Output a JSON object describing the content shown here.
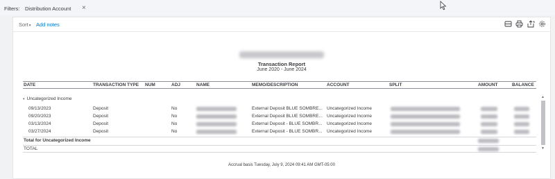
{
  "filters": {
    "label": "Filters:",
    "chip_label": "Distribution Account",
    "chip_remove": "×"
  },
  "toolbar": {
    "sort_label": "Sort",
    "sort_caret": "▾",
    "add_notes_label": "Add notes",
    "icons": [
      "collapse-icon",
      "print-icon",
      "export-icon",
      "settings-icon"
    ]
  },
  "report": {
    "title": "Transaction Report",
    "date_range": "June 2020 - June 2024",
    "columns": [
      "DATE",
      "TRANSACTION TYPE",
      "NUM",
      "ADJ",
      "NAME",
      "MEMO/DESCRIPTION",
      "ACCOUNT",
      "SPLIT",
      "AMOUNT",
      "BALANCE"
    ],
    "group_toggle": "▾",
    "group_label": "Uncategorized Income",
    "rows": [
      {
        "date": "09/13/2023",
        "type": "Deposit",
        "adj": "No",
        "memo": "External Deposit BLUE SOMBRE...",
        "account": "Uncategorized Income"
      },
      {
        "date": "09/20/2023",
        "type": "Deposit",
        "adj": "No",
        "memo": "External Deposit BLUE SOMBRE...",
        "account": "Uncategorized Income"
      },
      {
        "date": "03/13/2024",
        "type": "Deposit",
        "adj": "No",
        "memo": "External Deposit - BLUE SOMBR...",
        "account": "Uncategorized Income"
      },
      {
        "date": "03/27/2024",
        "type": "Deposit",
        "adj": "No",
        "memo": "External Deposit - BLUE SOMBR...",
        "account": "Uncategorized Income"
      }
    ],
    "total_group_label": "Total for Uncategorized Income",
    "total_label": "TOTAL",
    "footer": "Accrual basis  Tuesday, July 9, 2024  09:41 AM GMT-05:00"
  },
  "colors": {
    "accent_link": "#0077c5",
    "text": "#393a3d",
    "page_bg": "#f1f2f4"
  }
}
